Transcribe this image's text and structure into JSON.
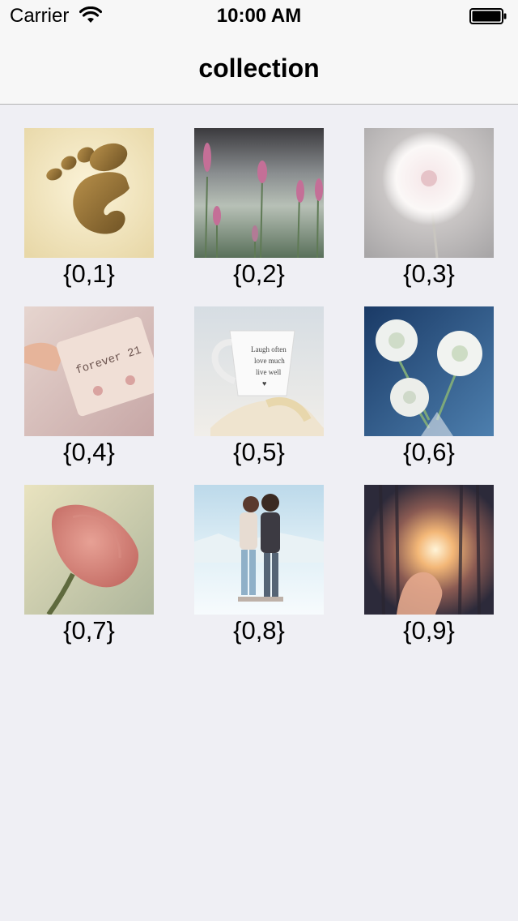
{
  "status_bar": {
    "carrier": "Carrier",
    "time": "10:00 AM",
    "wifi_icon": "wifi-icon",
    "battery_icon": "battery-full-icon"
  },
  "nav": {
    "title": "collection"
  },
  "colors": {
    "background": "#efeff4",
    "bar_background": "#f7f7f7",
    "separator": "#b2b2b2",
    "text": "#000000"
  },
  "cells": [
    {
      "label": "{0,1}",
      "image": "gnome-foot-logo"
    },
    {
      "label": "{0,2}",
      "image": "pink-lavender-flowers"
    },
    {
      "label": "{0,3}",
      "image": "dandelion-seed-head"
    },
    {
      "label": "{0,4}",
      "image": "hand-holding-earring-card"
    },
    {
      "label": "{0,5}",
      "image": "white-mug-with-tape-measure"
    },
    {
      "label": "{0,6}",
      "image": "white-ranunculus-flowers"
    },
    {
      "label": "{0,7}",
      "image": "pink-rose-closeup"
    },
    {
      "label": "{0,8}",
      "image": "couple-in-snow"
    },
    {
      "label": "{0,9}",
      "image": "sunlight-through-trees-hand"
    }
  ]
}
